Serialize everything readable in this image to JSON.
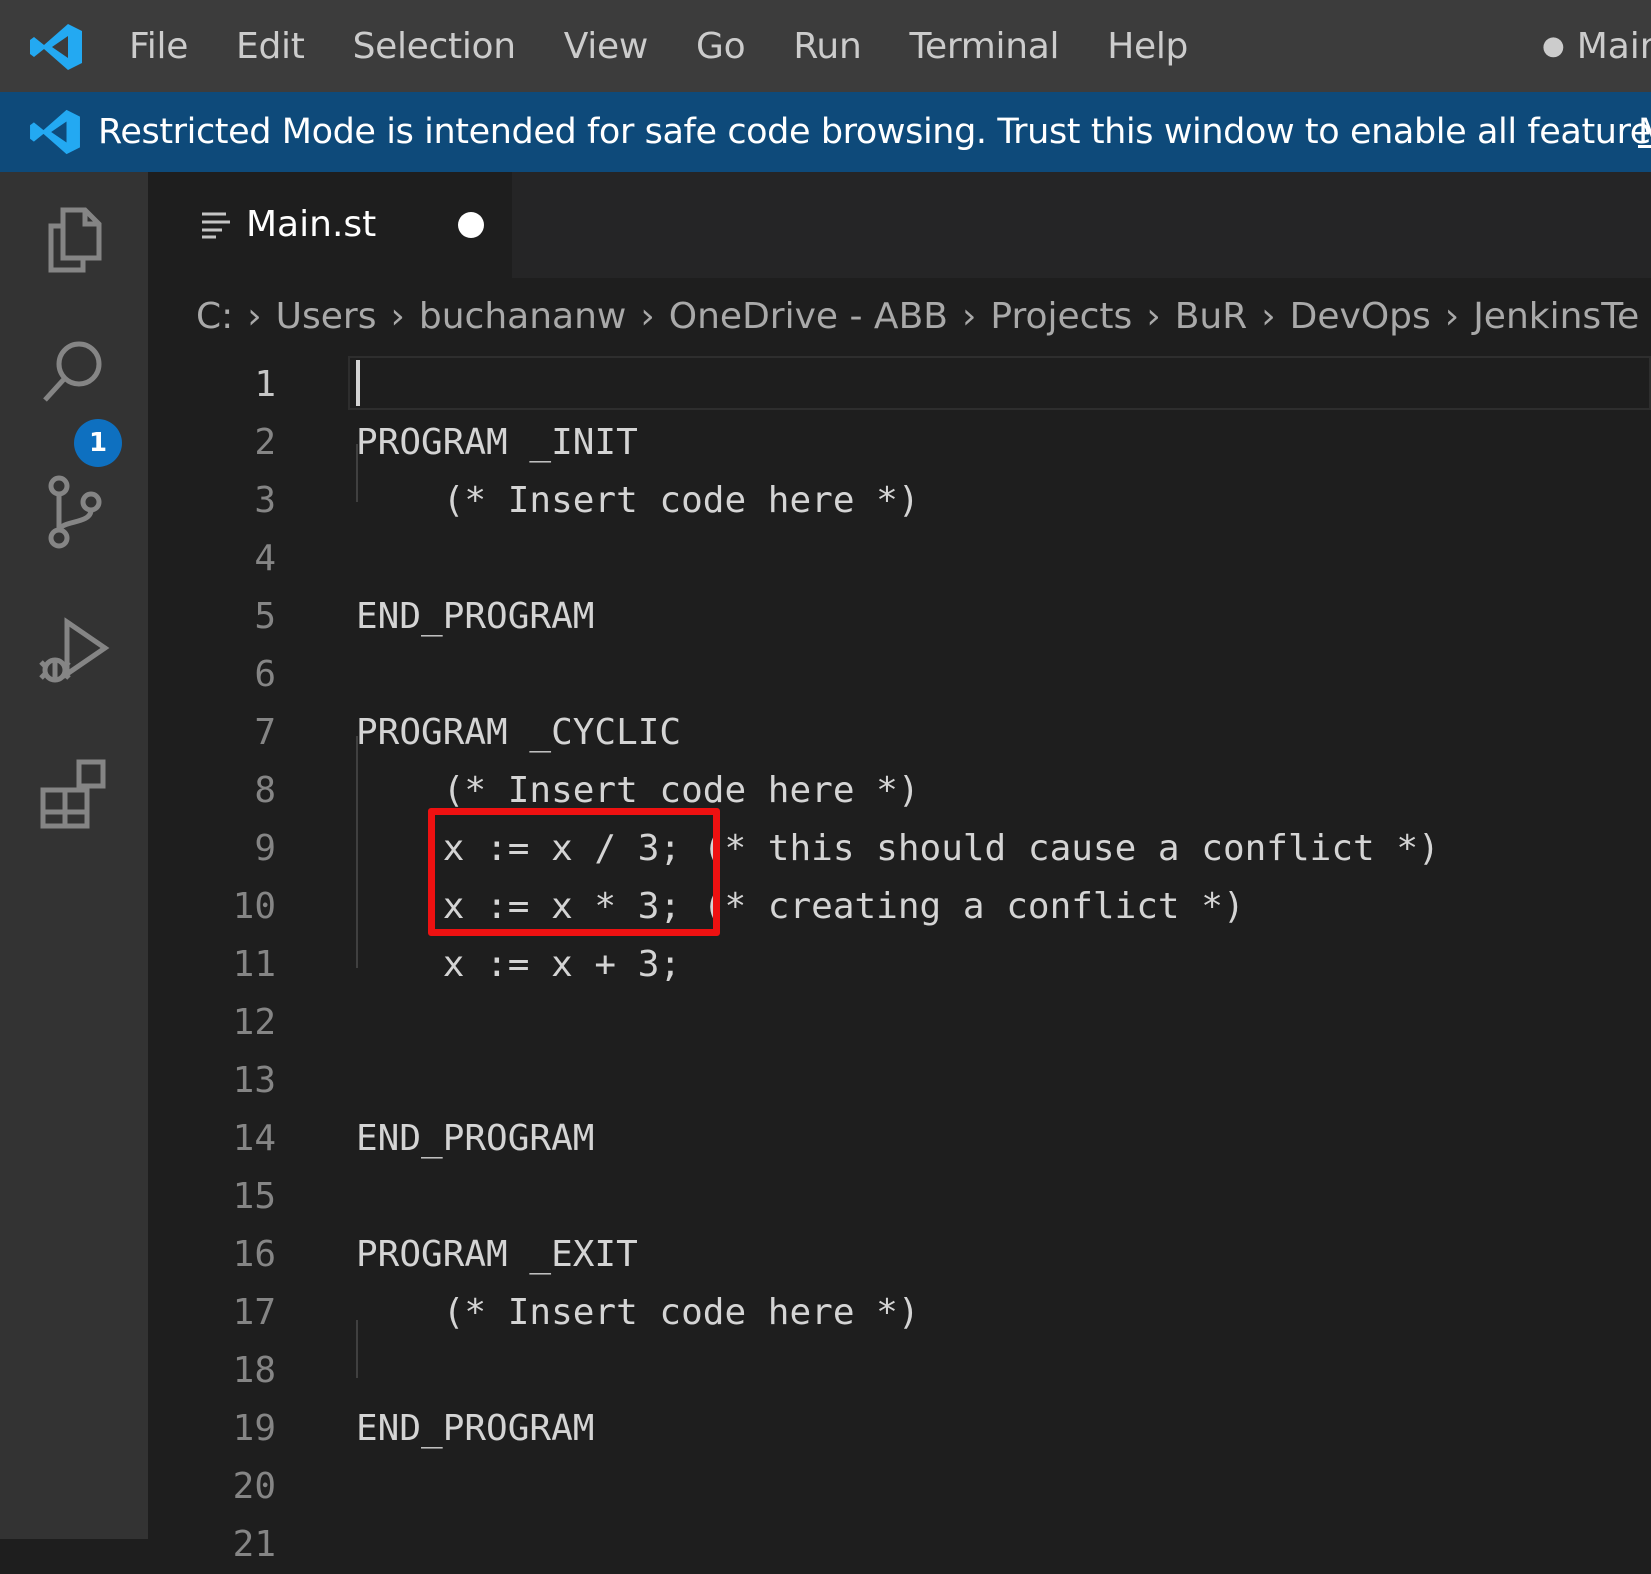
{
  "menubar": {
    "items": [
      "File",
      "Edit",
      "Selection",
      "View",
      "Go",
      "Run",
      "Terminal",
      "Help"
    ],
    "window_title": "Main"
  },
  "banner": {
    "text": "Restricted Mode is intended for safe code browsing. Trust this window to enable all features.",
    "link": "M"
  },
  "activity_bar": {
    "items": [
      "files-icon",
      "search-icon",
      "source-control-icon",
      "run-debug-icon",
      "extensions-icon"
    ],
    "badge": "1"
  },
  "tab": {
    "label": "Main.st",
    "dirty": true
  },
  "breadcrumb": [
    "C:",
    "Users",
    "buchananw",
    "OneDrive - ABB",
    "Projects",
    "BuR",
    "DevOps",
    "JenkinsTe"
  ],
  "editor": {
    "lines": [
      {
        "n": "1",
        "text": ""
      },
      {
        "n": "2",
        "text": "PROGRAM _INIT"
      },
      {
        "n": "3",
        "text": "    (* Insert code here *)"
      },
      {
        "n": "4",
        "text": ""
      },
      {
        "n": "5",
        "text": "END_PROGRAM"
      },
      {
        "n": "6",
        "text": ""
      },
      {
        "n": "7",
        "text": "PROGRAM _CYCLIC"
      },
      {
        "n": "8",
        "text": "    (* Insert code here *)"
      },
      {
        "n": "9",
        "text": "    x := x / 3; (* this should cause a conflict *)"
      },
      {
        "n": "10",
        "text": "    x := x * 3; (* creating a conflict *)"
      },
      {
        "n": "11",
        "text": "    x := x + 3;"
      },
      {
        "n": "12",
        "text": ""
      },
      {
        "n": "13",
        "text": ""
      },
      {
        "n": "14",
        "text": "END_PROGRAM"
      },
      {
        "n": "15",
        "text": ""
      },
      {
        "n": "16",
        "text": "PROGRAM _EXIT"
      },
      {
        "n": "17",
        "text": "    (* Insert code here *)"
      },
      {
        "n": "18",
        "text": ""
      },
      {
        "n": "19",
        "text": "END_PROGRAM"
      },
      {
        "n": "20",
        "text": ""
      },
      {
        "n": "21",
        "text": ""
      }
    ]
  },
  "colors": {
    "accent": "#0e70c0",
    "banner": "#0e4a7a",
    "highlight": "#ee1111"
  }
}
